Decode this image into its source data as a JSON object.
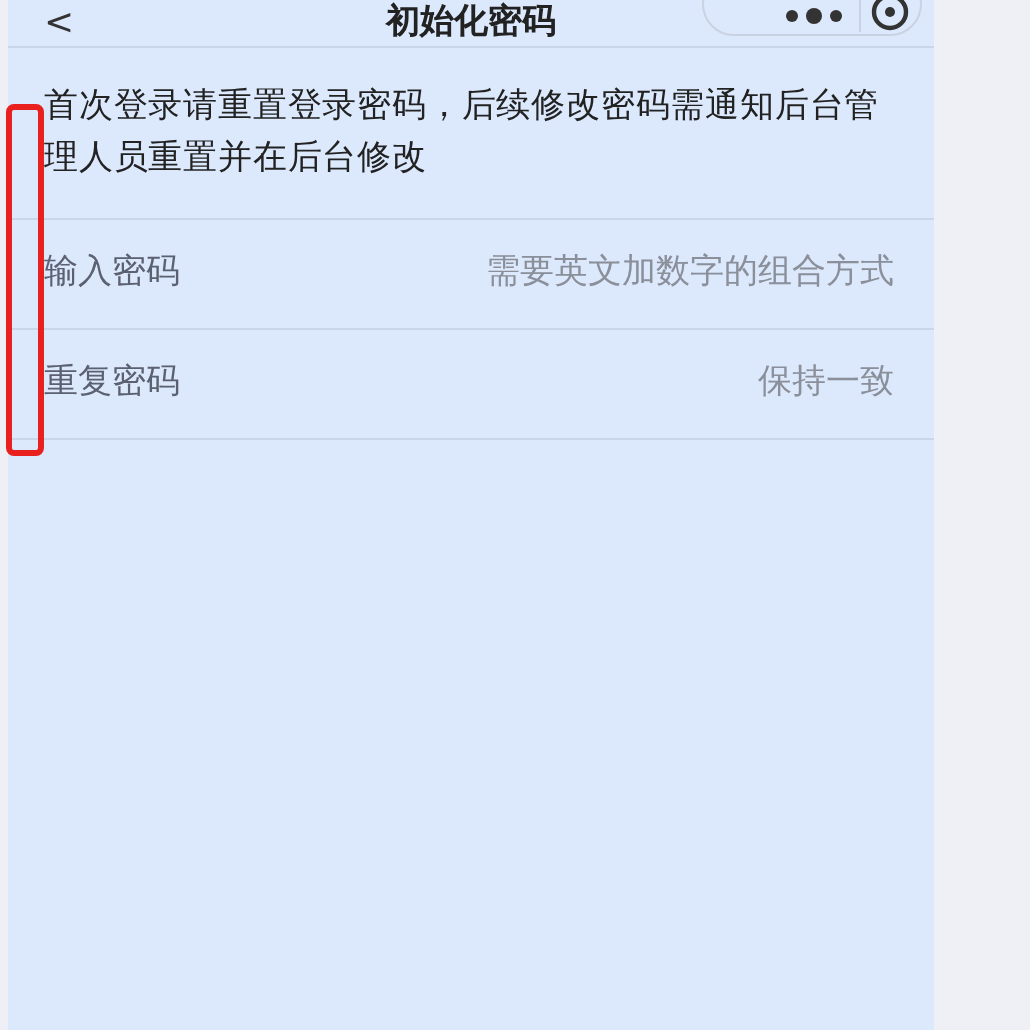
{
  "header": {
    "title": "初始化密码",
    "back_icon": "<"
  },
  "notice": "首次登录请重置登录密码，后续修改密码需通知后台管理人员重置并在后台修改",
  "fields": [
    {
      "label": "输入密码",
      "placeholder": "需要英文加数字的组合方式"
    },
    {
      "label": "重复密码",
      "placeholder": "保持一致"
    }
  ],
  "annotation": {
    "color": "#e8201e"
  }
}
